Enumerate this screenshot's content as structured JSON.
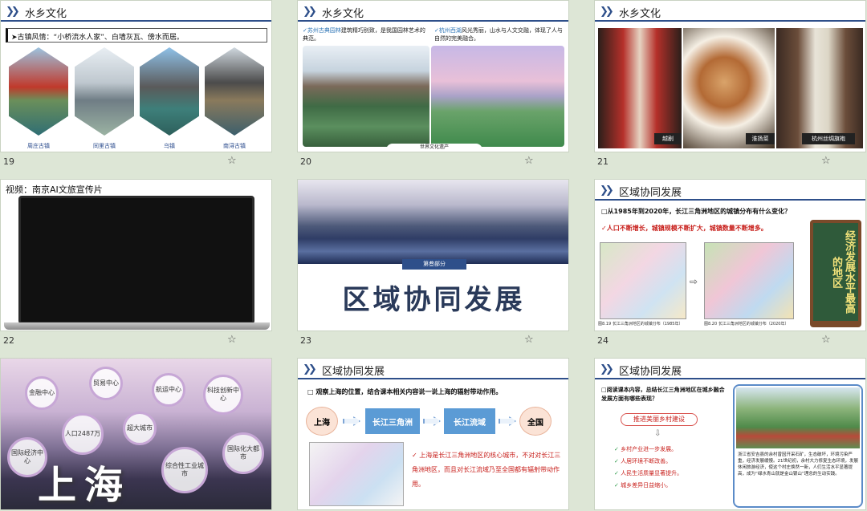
{
  "slides": [
    {
      "num": "19",
      "title": "水乡文化",
      "subtitle": "➤古镇风情：“小桥流水人家”、白墙灰瓦、傍水而居。",
      "captions": [
        "周庄古镇",
        "同里古镇",
        "乌镇",
        "南浔古镇"
      ]
    },
    {
      "num": "20",
      "title": "水乡文化",
      "left_text_head": "苏州古典园林",
      "left_text": "建筑精巧别致，是我国园林艺术的典范。",
      "right_text_head": "杭州西湖",
      "right_text": "风光秀丽，山水与人文交融，体现了人与自然的完美融合。",
      "banner": "世界文化遗产"
    },
    {
      "num": "21",
      "title": "水乡文化",
      "captions": [
        "越剧",
        "淮扬菜",
        "杭州丝绸旗袍"
      ]
    },
    {
      "num": "22",
      "title": "视频：南京AI文旅宣传片"
    },
    {
      "num": "23",
      "tag": "第叁部分",
      "big_title": "区域协同发展"
    },
    {
      "num": "24",
      "title": "区域协同发展",
      "question": "从1985年到2020年，长江三角洲地区的城镇分布有什么变化？",
      "answer": "人口不断增长，城镇规模不断扩大，城镇数量不断增多。",
      "board": "经济发展水平最高的地区",
      "map_captions": [
        "图8.19  长江三角洲地区的城镇分布（1985年）",
        "图8.20  长江三角洲地区的城镇分布（2020年）"
      ]
    },
    {
      "num": "25",
      "big": "上海",
      "bubbles": [
        "金融中心",
        "贸易中心",
        "航运中心",
        "科技创新中心",
        "人口2487万",
        "超大城市",
        "国际经济中心",
        "综合性工业城市",
        "国际化大都市"
      ]
    },
    {
      "num": "26",
      "title": "区域协同发展",
      "question": "观察上海的位置，结合课本相关内容说一说上海的辐射带动作用。",
      "flow": [
        "上海",
        "长江三角洲",
        "长江流域",
        "全国"
      ],
      "answer": "上海是长江三角洲地区的核心城市，不对对长江三角洲地区，而且对长江流域乃至全国都有辐射带动作用。"
    },
    {
      "num": "27",
      "title": "区域协同发展",
      "question": "阅读课本内容，总结长江三角洲地区在城乡融合发展方面有哪些表现？",
      "pill": "推进美丽乡村建设",
      "points": [
        "乡村产业进一步发展。",
        "人居环境不断改善。",
        "人民生活质量显著提升。",
        "城乡差异日益缩小。"
      ],
      "photo_text": "浙江省安吉县的余村曾因开采石矿，生态破坏，环境污染严重，经济发展缓慢。21世纪初，余村大力修复生态环境，发展休闲旅游经济，使这个村庄焕然一新，人们生活水平显著提高，成为“绿水青山就是金山银山”理念的生动实践。"
    }
  ]
}
